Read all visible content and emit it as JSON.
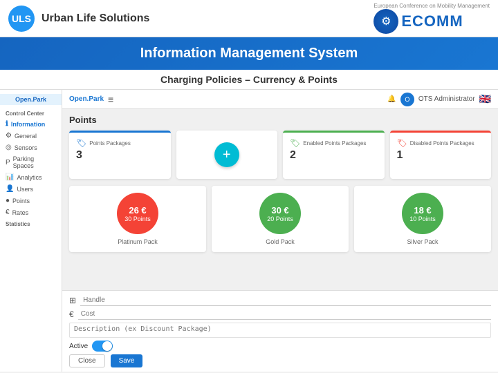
{
  "header": {
    "logo_text": "ULS",
    "title": "Urban Life Solutions",
    "ecomm_subtitle": "European Conference on Mobility Management",
    "ecomm_label": "ECOMM"
  },
  "banner": {
    "title": "Information Management System"
  },
  "sub_banner": {
    "title": "Charging Policies – Currency & Points"
  },
  "sidebar": {
    "app_label": "Open.Park",
    "hamburger": "≡",
    "sections": [
      {
        "title": "Control Center",
        "items": []
      },
      {
        "title": "",
        "items": [
          {
            "label": "Information",
            "icon": "ℹ",
            "active": true
          },
          {
            "label": "General",
            "icon": "⚙"
          },
          {
            "label": "Sensors",
            "icon": "◎"
          },
          {
            "label": "Parking Spaces",
            "icon": "P"
          },
          {
            "label": "Analytics",
            "icon": "📊"
          },
          {
            "label": "Users",
            "icon": "👤"
          },
          {
            "label": "Points",
            "icon": "●",
            "active": false
          },
          {
            "label": "Rates",
            "icon": "€"
          }
        ]
      },
      {
        "title": "Statistics",
        "items": []
      }
    ]
  },
  "content_header": {
    "openpark": "Open.Park",
    "user": "OTS Administrator",
    "bell_icon": "🔔"
  },
  "points_section": {
    "title": "Points",
    "stats": [
      {
        "label": "Points Packages",
        "value": "3",
        "color": "blue"
      },
      {
        "label": "Enabled Points Packages",
        "value": "2",
        "color": "green"
      },
      {
        "label": "Disabled Points Packages",
        "value": "1",
        "color": "red"
      }
    ],
    "add_button": "+",
    "packs": [
      {
        "name": "Platinum Pack",
        "price": "26 €",
        "points": "30 Points",
        "color": "platinum"
      },
      {
        "name": "Gold Pack",
        "price": "30 €",
        "points": "20 Points",
        "color": "gold"
      },
      {
        "name": "Silver Pack",
        "price": "18 €",
        "points": "10 Points",
        "color": "silver"
      }
    ]
  },
  "form": {
    "handle_placeholder": "Handle",
    "cost_placeholder": "Cost",
    "description_placeholder": "Description (ex Discount Package)",
    "active_label": "Active",
    "close_button": "Close",
    "save_button": "Save"
  }
}
